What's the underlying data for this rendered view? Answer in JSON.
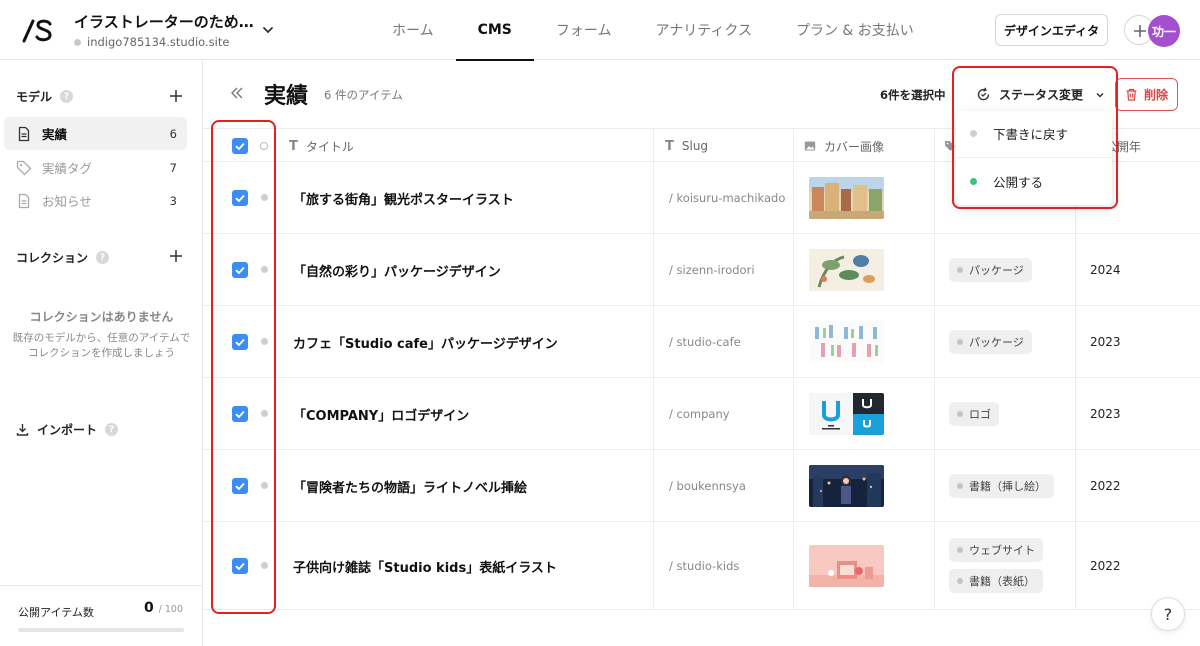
{
  "header": {
    "site_title": "イラストレーターのため…",
    "site_url": "indigo785134.studio.site",
    "nav": [
      {
        "label": "ホーム",
        "active": false
      },
      {
        "label": "CMS",
        "active": true
      },
      {
        "label": "フォーム",
        "active": false
      },
      {
        "label": "アナリティクス",
        "active": false
      },
      {
        "label": "プラン & お支払い",
        "active": false
      }
    ],
    "design_editor": "デザインエディタ",
    "avatar": "功一"
  },
  "sidebar": {
    "models_label": "モデル",
    "models": [
      {
        "label": "実績",
        "count": "6",
        "active": true,
        "icon": "document-icon"
      },
      {
        "label": "実績タグ",
        "count": "7",
        "active": false,
        "icon": "tag-icon"
      },
      {
        "label": "お知らせ",
        "count": "3",
        "active": false,
        "icon": "document-icon"
      }
    ],
    "collections_label": "コレクション",
    "empty_title": "コレクションはありません",
    "empty_desc_1": "既存のモデルから、任意のアイテムで",
    "empty_desc_2": "コレクションを作成しましょう",
    "import_label": "インポート",
    "published_label": "公開アイテム数",
    "published_count": "0",
    "published_total": "/ 100",
    "published_fraction": 0
  },
  "main": {
    "title": "実績",
    "item_count": "6 件のアイテム",
    "selected": "6件を選択中",
    "status_button": "ステータス変更",
    "delete_button": "削除",
    "dropdown": [
      {
        "label": "下書きに戻す",
        "dot": "#cfcfcf"
      },
      {
        "label": "公開する",
        "dot": "#3cc47c"
      }
    ],
    "columns": {
      "title": "タイトル",
      "slug": "Slug",
      "cover": "カバー画像",
      "year": "公開年"
    },
    "rows": [
      {
        "title": "「旅する街角」観光ポスターイラスト",
        "slug": "/ koisuru-machikado",
        "tags": [],
        "year": "24"
      },
      {
        "title": "「自然の彩り」パッケージデザイン",
        "slug": "/ sizenn-irodori",
        "tags": [
          "パッケージ"
        ],
        "year": "2024"
      },
      {
        "title": "カフェ「Studio cafe」パッケージデザイン",
        "slug": "/ studio-cafe",
        "tags": [
          "パッケージ"
        ],
        "year": "2023"
      },
      {
        "title": "「COMPANY」ロゴデザイン",
        "slug": "/ company",
        "tags": [
          "ロゴ"
        ],
        "year": "2023"
      },
      {
        "title": "「冒険者たちの物語」ライトノベル挿絵",
        "slug": "/ boukennsya",
        "tags": [
          "書籍（挿し絵）"
        ],
        "year": "2022"
      },
      {
        "title": "子供向け雑誌「Studio kids」表紙イラスト",
        "slug": "/ studio-kids",
        "tags": [
          "ウェブサイト",
          "書籍（表紙）"
        ],
        "year": "2022"
      }
    ]
  },
  "colors": {
    "accent": "#3d8ef0",
    "highlight": "#e22222",
    "avatar": "#a44ed0",
    "published": "#3cc47c"
  }
}
